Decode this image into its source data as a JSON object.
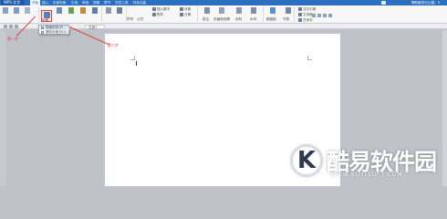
{
  "titlebar": {
    "app_button": "WPS 文字",
    "tabs": [
      "开始",
      "插入",
      "页面布局",
      "引用",
      "审阅",
      "视图",
      "章节",
      "开发工具",
      "特色功能"
    ],
    "right_text": "帮助服务已上线"
  },
  "ribbon": {
    "cover_page": "封面",
    "insert_number": "插入数字",
    "attachment": "附件",
    "date": "日期",
    "comment": "批注",
    "page_header": "页眉和页脚",
    "page_number": "页码",
    "watermark": "水印",
    "hyperlink": "超链接",
    "bookmark": "书签",
    "cross_ref": "交叉引用",
    "textbox": "文本框",
    "wordart": "艺术字",
    "symbol": "符号",
    "formula": "公式",
    "object": "对象"
  },
  "dropdown": {
    "items": [
      "库面封页(P)",
      "删除封面页(D)"
    ]
  },
  "doc_tab": "文档1",
  "annotations": {
    "step1": "第一步",
    "step2": "第二步"
  },
  "watermark": {
    "letter": "K",
    "title": "酷易软件园",
    "url": "WWW.KUYISOFT.COM"
  },
  "colors": {
    "title_bar": "#2c6fbf",
    "annotation": "#e23b3b",
    "canvas": "#bfc3c9"
  }
}
